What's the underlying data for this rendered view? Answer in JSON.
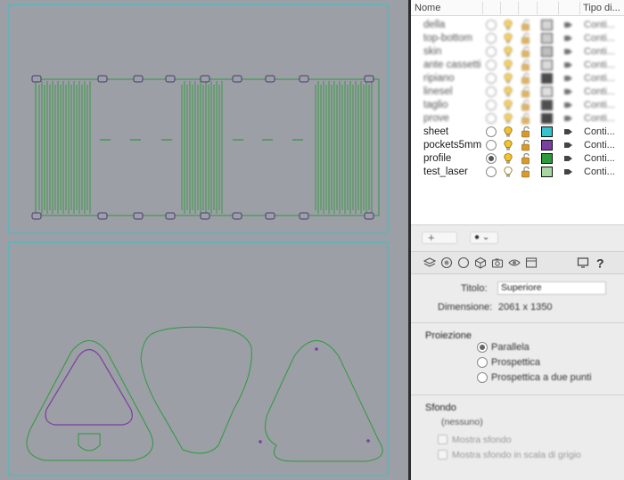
{
  "layers_panel": {
    "columns": {
      "name": "Nome",
      "type": "Tipo di..."
    },
    "layers": [
      {
        "name": "della",
        "blurred": true,
        "color": "#c8c8c8",
        "type": "Conti..."
      },
      {
        "name": "top-bottom",
        "blurred": true,
        "color": "#bdbdbd",
        "type": "Conti..."
      },
      {
        "name": "skin",
        "blurred": true,
        "color": "#a9a9a9",
        "type": "Conti..."
      },
      {
        "name": "ante cassetti",
        "blurred": true,
        "color": "#cfcfcf",
        "type": "Conti..."
      },
      {
        "name": "ripiano",
        "blurred": true,
        "color": "#111111",
        "type": "Conti..."
      },
      {
        "name": "linesel",
        "blurred": true,
        "color": "#d5d5d5",
        "type": "Conti..."
      },
      {
        "name": "taglio",
        "blurred": true,
        "color": "#151515",
        "type": "Conti..."
      },
      {
        "name": "prove",
        "blurred": true,
        "color": "#0c0c0c",
        "type": "Conti..."
      },
      {
        "name": "sheet",
        "blurred": false,
        "current": false,
        "color": "#36c3cc",
        "type": "Conti..."
      },
      {
        "name": "pockets5mm",
        "blurred": false,
        "current": false,
        "color": "#7a3fa0",
        "type": "Conti..."
      },
      {
        "name": "profile",
        "blurred": false,
        "current": true,
        "color": "#2e9a3e",
        "type": "Conti..."
      },
      {
        "name": "test_laser",
        "blurred": false,
        "current": false,
        "color": "#a8d8a0",
        "type": "Conti..."
      }
    ]
  },
  "toolbar": {
    "add_label": "+",
    "options_label": "● ⌄"
  },
  "tabs": [
    "layers-tab-icon",
    "materials-tab-icon",
    "object-tab-icon",
    "camera-tab-icon",
    "viewport-tab-icon",
    "display-tab-icon",
    "render-tab-icon",
    "help-icon"
  ],
  "properties": {
    "title_label": "Titolo:",
    "title_value": "Superiore",
    "dimension_label": "Dimensione:",
    "dimension_value": "2061 x 1350",
    "projection_title": "Proiezione",
    "projection_options": [
      "Parallela",
      "Prospettica",
      "Prospettica a due punti"
    ],
    "projection_selected": 0,
    "background_title": "Sfondo",
    "background_value": "(nessuno)",
    "bg_checkboxes": [
      "Mostra sfondo",
      "Mostra sfondo in scala di grigio"
    ]
  },
  "colors": {
    "viewport_bg": "#9c9fa5",
    "sheet_outline": "#36c3cc",
    "profile_line": "#2e9a3e",
    "pocket_line": "#7a3fa0"
  }
}
